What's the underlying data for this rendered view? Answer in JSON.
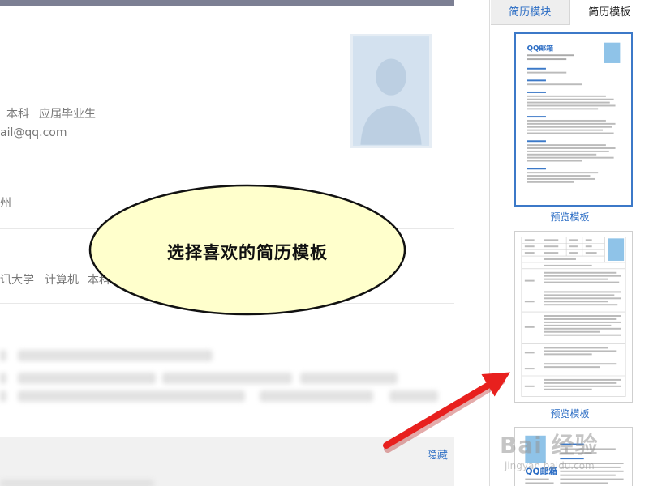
{
  "editor": {
    "degree": "本科",
    "status": "应届毕业生",
    "email_fragment": "ail@qq.com",
    "city_fragment": "州",
    "school": "讯大学",
    "major": "计算机",
    "degree_fragment": "本科",
    "hide_label": "隐藏"
  },
  "panel": {
    "tabs": [
      {
        "label": "简历模块",
        "active": false
      },
      {
        "label": "简历模板",
        "active": true
      }
    ],
    "thumbs": [
      {
        "preview_label": "预览模板",
        "selected": true,
        "title": "QQ邮箱"
      },
      {
        "preview_label": "预览模板",
        "selected": false
      },
      {
        "title": "QQ邮箱"
      }
    ]
  },
  "overlay": {
    "callout_text": "选择喜欢的简历模板",
    "callout_fill": "#ffffcc",
    "arrow_color": "#e8201e"
  },
  "watermark": {
    "text": "Bai 经验",
    "subtext": "jingyan.baidu.com"
  },
  "colors": {
    "accent": "#2a6cc4",
    "selected_border": "#3c79c8",
    "header_strip": "#7c7f93"
  }
}
